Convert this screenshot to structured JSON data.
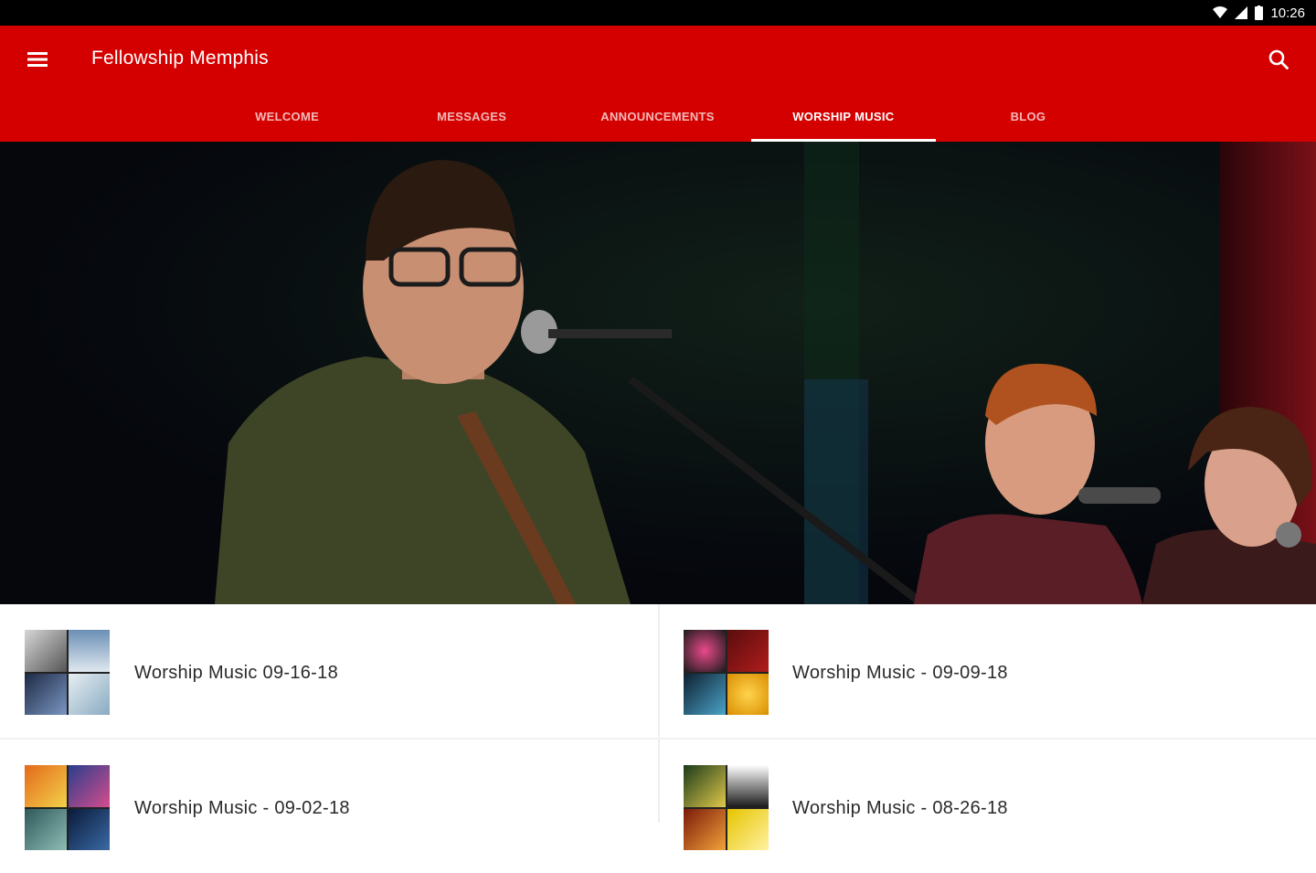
{
  "status": {
    "time": "10:26"
  },
  "header": {
    "title": "Fellowship Memphis",
    "menu_icon": "hamburger-menu-icon",
    "search_icon": "search-icon",
    "bg_color": "#d40000"
  },
  "tabs": [
    {
      "label": "WELCOME",
      "active": false
    },
    {
      "label": "MESSAGES",
      "active": false
    },
    {
      "label": "ANNOUNCEMENTS",
      "active": false
    },
    {
      "label": "WORSHIP MUSIC",
      "active": true
    },
    {
      "label": "BLOG",
      "active": false
    }
  ],
  "items": [
    {
      "title": "Worship Music 09-16-18"
    },
    {
      "title": "Worship Music - 09-09-18"
    },
    {
      "title": "Worship Music - 09-02-18"
    },
    {
      "title": "Worship Music - 08-26-18"
    }
  ]
}
